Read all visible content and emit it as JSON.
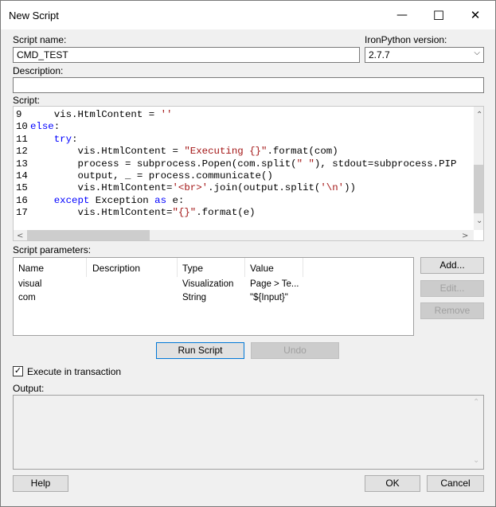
{
  "window": {
    "title": "New Script"
  },
  "labels": {
    "script_name": "Script name:",
    "ironpython_version": "IronPython version:",
    "description": "Description:",
    "script": "Script:",
    "script_parameters": "Script parameters:",
    "execute_in_transaction": "Execute in transaction",
    "output": "Output:"
  },
  "fields": {
    "script_name": "CMD_TEST",
    "ironpython_version": "2.7.7",
    "description": ""
  },
  "code": {
    "lines": [
      {
        "n": "9",
        "tokens": [
          {
            "t": "    vis.HtmlContent = "
          },
          {
            "t": "''",
            "c": "str"
          }
        ]
      },
      {
        "n": "10",
        "tokens": [
          {
            "t": "else",
            "c": "kw"
          },
          {
            "t": ":"
          }
        ]
      },
      {
        "n": "11",
        "tokens": [
          {
            "t": "    "
          },
          {
            "t": "try",
            "c": "kw"
          },
          {
            "t": ":"
          }
        ]
      },
      {
        "n": "12",
        "tokens": [
          {
            "t": "        vis.HtmlContent = "
          },
          {
            "t": "\"Executing {}\"",
            "c": "str"
          },
          {
            "t": ".format(com)"
          }
        ]
      },
      {
        "n": "13",
        "tokens": [
          {
            "t": "        process = subprocess.Popen(com.split("
          },
          {
            "t": "\" \"",
            "c": "str"
          },
          {
            "t": "), stdout=subprocess.PIP"
          }
        ]
      },
      {
        "n": "14",
        "tokens": [
          {
            "t": "        output, _ = process.communicate()"
          }
        ]
      },
      {
        "n": "15",
        "tokens": [
          {
            "t": "        vis.HtmlContent="
          },
          {
            "t": "'<br>'",
            "c": "str"
          },
          {
            "t": ".join(output.split("
          },
          {
            "t": "'\\n'",
            "c": "str"
          },
          {
            "t": "))"
          }
        ]
      },
      {
        "n": "16",
        "tokens": [
          {
            "t": "    "
          },
          {
            "t": "except",
            "c": "kw"
          },
          {
            "t": " Exception "
          },
          {
            "t": "as",
            "c": "kw"
          },
          {
            "t": " e:"
          }
        ]
      },
      {
        "n": "17",
        "tokens": [
          {
            "t": "        vis.HtmlContent="
          },
          {
            "t": "\"{}\"",
            "c": "str"
          },
          {
            "t": ".format(e)"
          }
        ]
      }
    ]
  },
  "params": {
    "headers": {
      "name": "Name",
      "description": "Description",
      "type": "Type",
      "value": "Value"
    },
    "rows": [
      {
        "name": "visual",
        "description": "",
        "type": "Visualization",
        "value": "Page > Te..."
      },
      {
        "name": "com",
        "description": "",
        "type": "String",
        "value": "\"${Input}\""
      }
    ]
  },
  "buttons": {
    "add": "Add...",
    "edit": "Edit...",
    "remove": "Remove",
    "run_script": "Run Script",
    "undo": "Undo",
    "help": "Help",
    "ok": "OK",
    "cancel": "Cancel"
  },
  "checkbox": {
    "execute_in_transaction": true,
    "mark": "✓"
  },
  "icons": {
    "minimize": "—",
    "maximize": "☐",
    "close": "✕",
    "dropdown": "⌵",
    "scroll_up": "⌃",
    "scroll_down": "⌄",
    "scroll_left": "<",
    "scroll_right": ">"
  },
  "output": {
    "text": ""
  }
}
